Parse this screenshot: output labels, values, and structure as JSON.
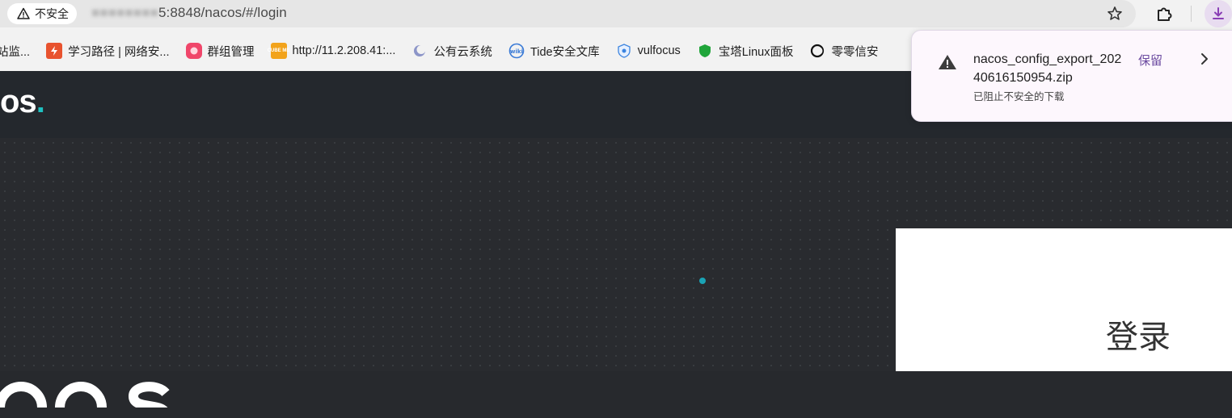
{
  "browser": {
    "insecure_label": "不安全",
    "url_visible": "5:8848/nacos/#/login"
  },
  "bookmarks": [
    {
      "label": "站监...",
      "icon": "site-icon"
    },
    {
      "label": "学习路径 | 网络安...",
      "icon": "lightning-icon"
    },
    {
      "label": "群组管理",
      "icon": "group-icon"
    },
    {
      "label": "http://11.2.208.41:...",
      "icon": "cube-icon",
      "icon_text": "CUBE ME"
    },
    {
      "label": "公有云系统",
      "icon": "cloud-icon"
    },
    {
      "label": "Tide安全文库",
      "icon": "wiki-icon"
    },
    {
      "label": "vulfocus",
      "icon": "gear-shield-icon"
    },
    {
      "label": "宝塔Linux面板",
      "icon": "pagoda-icon"
    },
    {
      "label": "零零信安",
      "icon": "ring-icon"
    }
  ],
  "download_popup": {
    "filename": "nacos_config_export_20240616150954.zip",
    "status": "已阻止不安全的下载",
    "keep_label": "保留"
  },
  "page": {
    "logo_partial": "os",
    "login_title": "登录"
  },
  "colors": {
    "accent_teal": "#1ec1c1",
    "header_bg": "#24282d",
    "download_accent": "#6b4aa0"
  }
}
